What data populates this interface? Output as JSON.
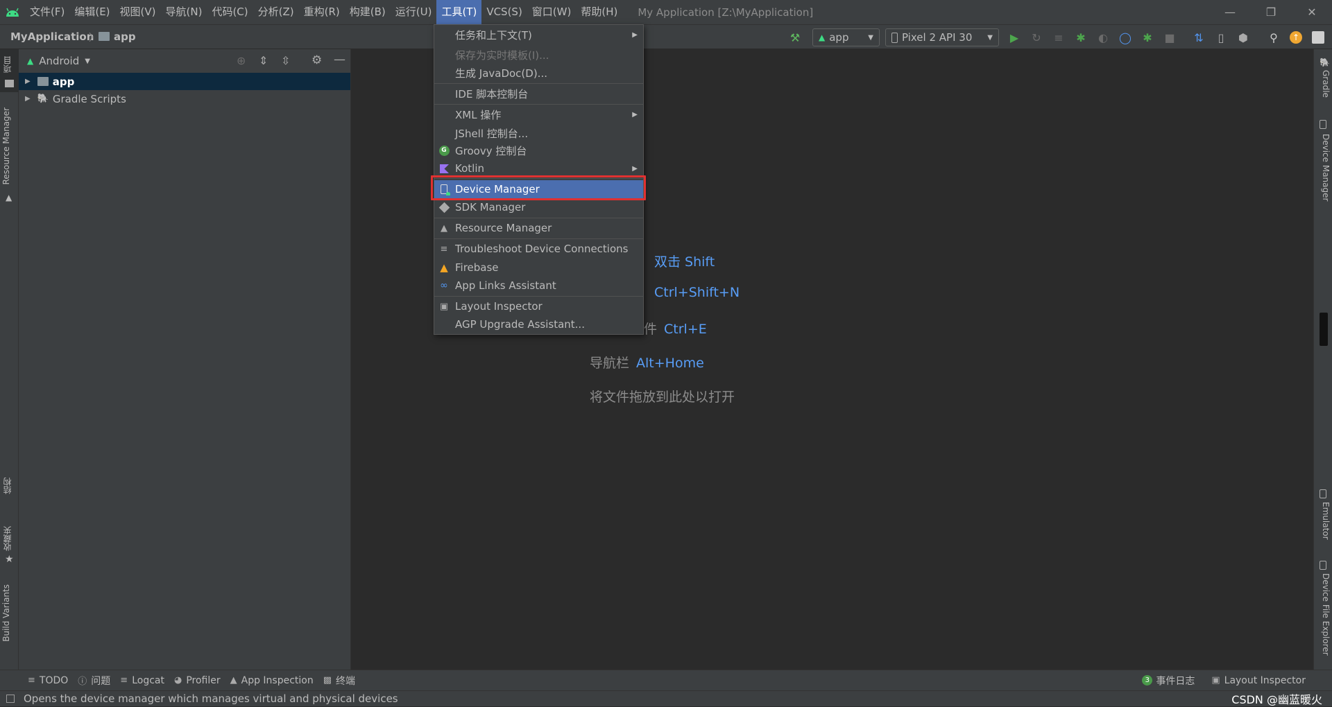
{
  "menubar": {
    "items": [
      "文件(F)",
      "编辑(E)",
      "视图(V)",
      "导航(N)",
      "代码(C)",
      "分析(Z)",
      "重构(R)",
      "构建(B)",
      "运行(U)",
      "工具(T)",
      "VCS(S)",
      "窗口(W)",
      "帮助(H)"
    ],
    "active_index": 9,
    "window_title": "My Application [Z:\\MyApplication]"
  },
  "toolbar": {
    "breadcrumb_project": "MyApplication",
    "breadcrumb_module": "app",
    "run_config": "app",
    "device": "Pixel 2 API 30"
  },
  "left_stripe": {
    "project_tab": "项目",
    "resource_manager_tab": "Resource Manager",
    "structure_tab": "结构",
    "favorites_tab": "收藏夹",
    "build_variants_tab": "Build Variants"
  },
  "right_stripe": {
    "gradle_tab": "Gradle",
    "device_manager_tab": "Device Manager",
    "emulator_tab": "Emulator",
    "device_file_explorer_tab": "Device File Explorer"
  },
  "project_panel": {
    "view_mode": "Android",
    "tree": [
      {
        "label": "app",
        "selected": true
      },
      {
        "label": "Gradle Scripts",
        "selected": false
      }
    ]
  },
  "editor_hints": [
    {
      "text": "",
      "key": "双击 Shift"
    },
    {
      "text": "",
      "key": "Ctrl+Shift+N"
    },
    {
      "text": "件",
      "key": "Ctrl+E"
    },
    {
      "text": "导航栏",
      "key": "Alt+Home"
    },
    {
      "text": "将文件拖放到此处以打开",
      "key": ""
    }
  ],
  "tools_menu": {
    "items": [
      {
        "label": "任务和上下文(T)",
        "submenu": true,
        "icon": ""
      },
      {
        "label": "保存为实时模板(I)...",
        "disabled": true,
        "icon": ""
      },
      {
        "label": "生成 JavaDoc(D)...",
        "icon": ""
      },
      {
        "label": "IDE 脚本控制台",
        "icon": ""
      },
      {
        "label": "XML 操作",
        "submenu": true,
        "icon": ""
      },
      {
        "label": "JShell 控制台...",
        "icon": ""
      },
      {
        "label": "Groovy 控制台",
        "icon": "groovy-icon"
      },
      {
        "label": "Kotlin",
        "submenu": true,
        "icon": "kotlin-icon"
      },
      {
        "label": "Device Manager",
        "highlight": true,
        "icon": "device-manager-icon"
      },
      {
        "label": "SDK Manager",
        "icon": "sdk-manager-icon"
      },
      {
        "label": "Resource Manager",
        "icon": "resource-manager-icon"
      },
      {
        "label": "Troubleshoot Device Connections",
        "icon": "list-icon"
      },
      {
        "label": "Firebase",
        "icon": "firebase-icon"
      },
      {
        "label": "App Links Assistant",
        "icon": "link-icon"
      },
      {
        "label": "Layout Inspector",
        "icon": "layout-inspector-icon"
      },
      {
        "label": "AGP Upgrade Assistant...",
        "icon": ""
      }
    ]
  },
  "bottom_tabs": {
    "todo": "TODO",
    "problems": "问题",
    "logcat": "Logcat",
    "profiler": "Profiler",
    "app_inspection": "App Inspection",
    "terminal": "终端",
    "event_log_count": "3",
    "event_log": "事件日志",
    "layout_inspector": "Layout Inspector"
  },
  "status_bar": {
    "message": "Opens the device manager which manages virtual and physical devices",
    "watermark": "CSDN @幽蓝暖火"
  },
  "colors": {
    "accent": "#4b6eaf",
    "highlight_box": "#e03131",
    "shortcut": "#589df6",
    "android_green": "#3ddc84"
  }
}
